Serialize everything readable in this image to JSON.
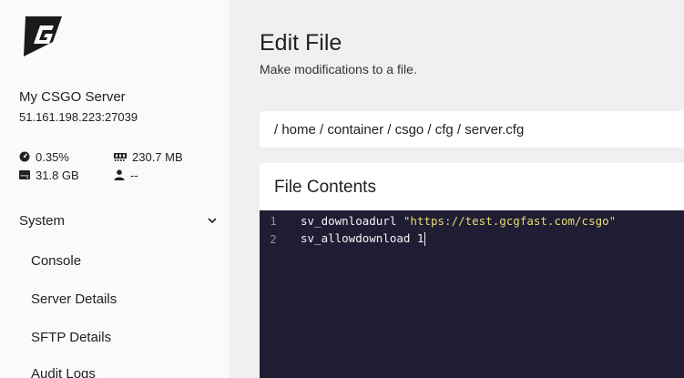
{
  "sidebar": {
    "server_name": "My CSGO Server",
    "server_ip": "51.161.198.223:27039",
    "stats": {
      "cpu": "0.35%",
      "memory": "230.7 MB",
      "disk": "31.8 GB",
      "players": "--"
    },
    "nav_group": "System",
    "items": [
      {
        "label": "Console"
      },
      {
        "label": "Server Details"
      },
      {
        "label": "SFTP Details"
      },
      {
        "label": "Audit Logs"
      }
    ]
  },
  "main": {
    "title": "Edit File",
    "subtitle": "Make modifications to a file.",
    "breadcrumb": "/ home / container / csgo / cfg / server.cfg",
    "file_card_title": "File Contents",
    "editor": {
      "lines": [
        {
          "num": "1",
          "keyword": "sv_downloadurl ",
          "string": "\"https://test.gcgfast.com/csgo\""
        },
        {
          "num": "2",
          "keyword": "sv_allowdownload 1",
          "string": ""
        }
      ]
    }
  },
  "colors": {
    "sidebar_bg": "#fafafa",
    "main_bg": "#f0f0f0",
    "editor_bg": "#1f1d33",
    "string_color": "#e6db74"
  }
}
